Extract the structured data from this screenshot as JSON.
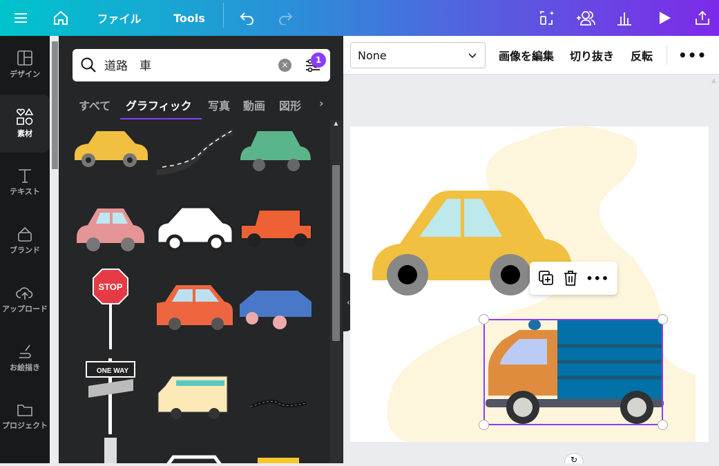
{
  "topbar": {
    "file_label": "ファイル",
    "tools_label": "Tools"
  },
  "rail": {
    "items": [
      {
        "label": "デザイン"
      },
      {
        "label": "素材"
      },
      {
        "label": "テキスト"
      },
      {
        "label": "ブランド"
      },
      {
        "label": "アップロード"
      },
      {
        "label": "お絵描き"
      },
      {
        "label": "プロジェクト"
      }
    ]
  },
  "search": {
    "value": "道路　車",
    "filter_badge": "1"
  },
  "tabs": [
    "すべて",
    "グラフィック",
    "写真",
    "動画",
    "図形"
  ],
  "thumbs": {
    "stop_sign": "STOP",
    "one_way": "ONE WAY"
  },
  "toolbar": {
    "select_value": "None",
    "edit_image": "画像を編集",
    "crop": "切り抜き",
    "flip": "反転"
  },
  "colors": {
    "accent": "#8b3dff",
    "panel": "#252627",
    "rail": "#18191b"
  }
}
